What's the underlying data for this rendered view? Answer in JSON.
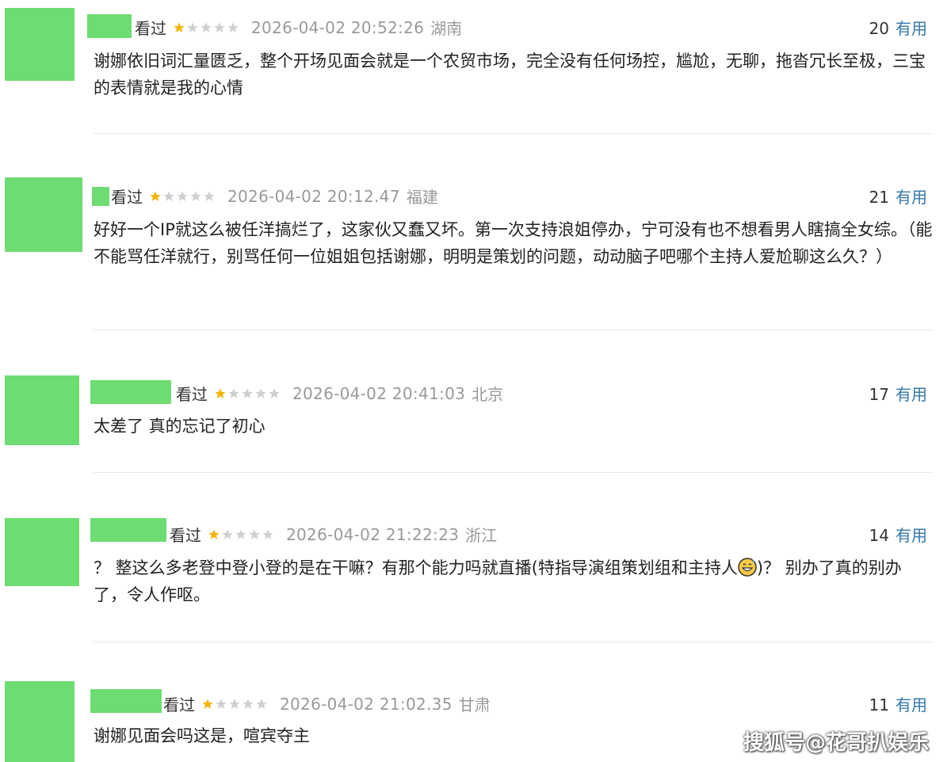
{
  "reviews": [
    {
      "status": "看过",
      "rating_stars": 1,
      "max_stars": 5,
      "time": "2026-04-02 20:52:26",
      "location": "湖南",
      "useful_count": "20",
      "useful_label": "有用",
      "text": "谢娜依旧词汇量匮乏，整个开场见面会就是一个农贸市场，完全没有任何场控，尴尬，无聊，拖沓冗长至极，三宝的表情就是我的心情"
    },
    {
      "status": "看过",
      "rating_stars": 1,
      "max_stars": 5,
      "time": "2026-04-02 20:12.47",
      "location": "福建",
      "useful_count": "21",
      "useful_label": "有用",
      "text": "好好一个IP就这么被任洋搞烂了，这家伙又蠢又坏。第一次支持浪姐停办，宁可没有也不想看男人瞎搞全女综。（能不能骂任洋就行，别骂任何一位姐姐包括谢娜，明明是策划的问题，动动脑子吧哪个主持人爱尬聊这么久？）"
    },
    {
      "status": "看过",
      "rating_stars": 1,
      "max_stars": 5,
      "time": "2026-04-02 20:41:03",
      "location": "北京",
      "useful_count": "17",
      "useful_label": "有用",
      "text": "太差了 真的忘记了初心"
    },
    {
      "status": "看过",
      "rating_stars": 1,
      "max_stars": 5,
      "time": "2026-04-02 21:22:23",
      "location": "浙江",
      "useful_count": "14",
      "useful_label": "有用",
      "text_before": "？ 整这么多老登中登小登的是在干嘛？有那个能力吗就直播(特指导演组策划组和主持人",
      "text_after": ")？ 别办了真的别办了，令人作呕。"
    },
    {
      "status": "看过",
      "rating_stars": 1,
      "max_stars": 5,
      "time": "2026-04-02 21:02.35",
      "location": "甘肃",
      "useful_count": "11",
      "useful_label": "有用",
      "text": "谢娜见面会吗这是，喧宾夺主"
    }
  ],
  "watermark": "搜狐号@花哥扒娱乐"
}
